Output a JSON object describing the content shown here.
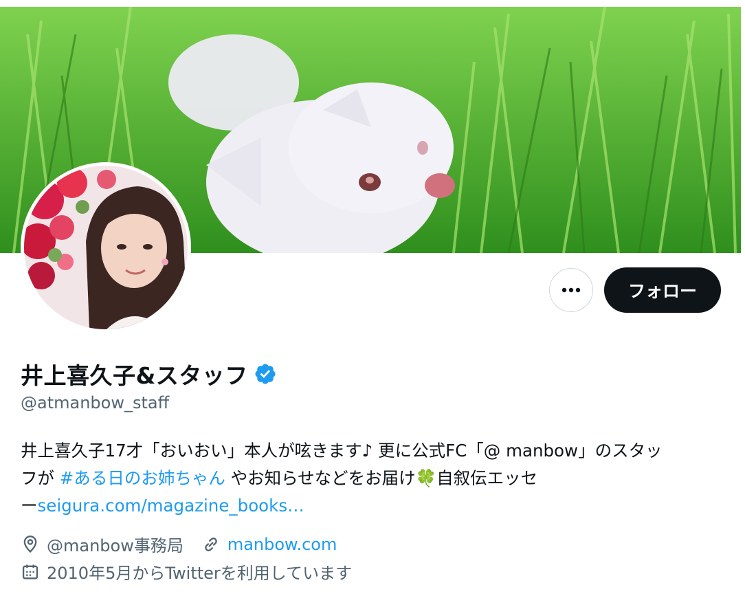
{
  "profile": {
    "name": "井上喜久子&スタッフ",
    "handle": "@atmanbow_staff",
    "verified": true,
    "follow_label": "フォロー",
    "more_label": "•••",
    "bio": {
      "line1_text": "井上喜久子17才「おいおい」本人が呟きます♪ 更に公式FC「@ manbow」のスタッ",
      "line2_prefix": "フが ",
      "hashtag": "#ある日のお姉ちゃん",
      "line2_middle": " やお知らせなどをお届け",
      "clover": "🍀",
      "line2_suffix": "自叙伝エッセ",
      "line3_prefix": "ー",
      "url": "seigura.com/magazine_books…"
    },
    "location": "@manbow事務局",
    "website": "manbow.com",
    "joined": "2010年5月からTwitterを利用しています"
  },
  "icons": {
    "verified": "verified-badge-icon",
    "location": "location-pin-icon",
    "link": "link-icon",
    "calendar": "calendar-icon",
    "more": "more-dots-icon"
  },
  "colors": {
    "accent": "#1d9bf0",
    "text": "#0f1419",
    "secondary": "#536471",
    "button_dark": "#0f1419"
  }
}
